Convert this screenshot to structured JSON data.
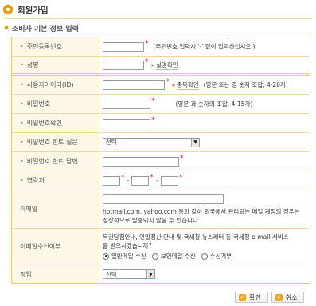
{
  "header": {
    "title": "회원가입"
  },
  "section": {
    "title": "소비자 기본 정보 입력"
  },
  "form": {
    "bullet": "•",
    "required_mark": "*",
    "rrn": {
      "label": "주민등록번호",
      "hint": "(주민번호 입력시 '-' 없이 입력하십시오.)"
    },
    "name": {
      "label": "성명",
      "button": "실명확인"
    },
    "user_id": {
      "label": "사용자아이디(ID)",
      "button": "중복확인",
      "hint": "(영문 또는 영 숫자 조합, 4-20자)"
    },
    "password": {
      "label": "비밀번호",
      "hint": "(영문 과 숫자의 조합, 4-15자)"
    },
    "password_confirm": {
      "label": "비밀번호확인"
    },
    "hint_question": {
      "label": "비밀번호 힌트 질문",
      "selected": "선택"
    },
    "hint_answer": {
      "label": "비밀번호 힌트 답변"
    },
    "phone": {
      "label": "연락처",
      "separator": "-"
    },
    "email": {
      "label": "이메일",
      "note_line1": "hotmail.com, yahoo.com 등과 같이 외국에서 관리되는 메일 계정의 경우는",
      "note_line2": "정상적으로 발송되지 않을 수 있습니다."
    },
    "email_subscribe": {
      "label": "이메일수신여부",
      "note_line1": "복권당첨안내, 연말정산 안내 및 국세청 뉴스레터 등 국세청 e-mail 서비스",
      "note_line2": "를 받으시겠습니까?",
      "options": [
        "일반메일 수신",
        "보안메일 수신",
        "수신거부"
      ],
      "selected": "일반메일 수신"
    },
    "job": {
      "label": "직업",
      "selected": "선택"
    }
  },
  "actions": {
    "confirm": "확인",
    "cancel": "취소"
  }
}
